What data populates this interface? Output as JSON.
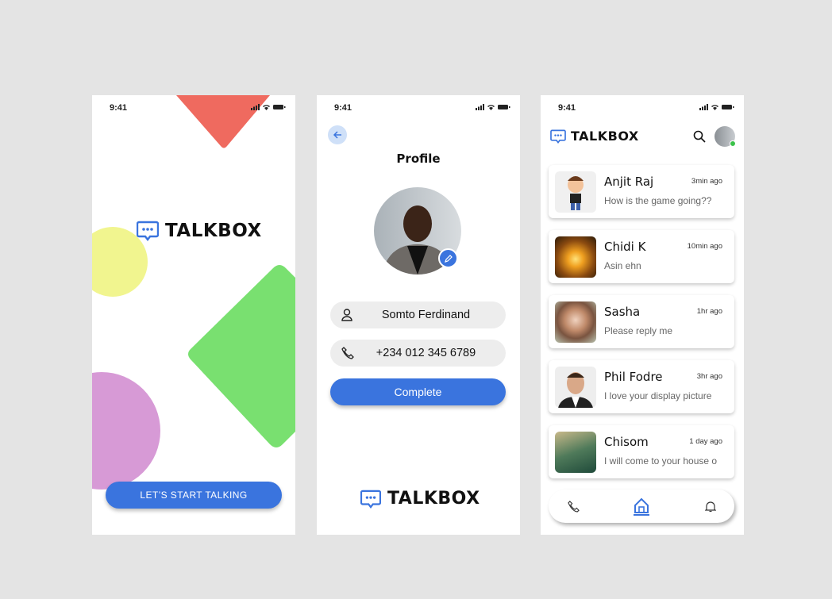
{
  "status_bar": {
    "time": "9:41"
  },
  "brand": {
    "name": "TALKBOX",
    "accent": "#3a74de"
  },
  "splash": {
    "cta": "LET’S START TALKING",
    "shapes": {
      "triangle": "#ef6a5f",
      "yellow_circle": "#f1f58f",
      "green_diamond": "#79e070",
      "purple_circle": "#d79ad6"
    }
  },
  "profile": {
    "title": "Profile",
    "name": "Somto Ferdinand",
    "phone": "+234 012 345 6789",
    "complete": "Complete"
  },
  "chats": {
    "items": [
      {
        "name": "Anjit Raj",
        "time": "3min ago",
        "message": "How is the game going??"
      },
      {
        "name": "Chidi K",
        "time": "10min ago",
        "message": "Asin ehn"
      },
      {
        "name": "Sasha",
        "time": "1hr ago",
        "message": "Please reply me"
      },
      {
        "name": "Phil Fodre",
        "time": "3hr ago",
        "message": "I love your display picture"
      },
      {
        "name": "Chisom",
        "time": "1 day ago",
        "message": "I will come to your house o"
      }
    ],
    "nav": [
      "call",
      "home",
      "notifications"
    ],
    "nav_active": "home"
  }
}
